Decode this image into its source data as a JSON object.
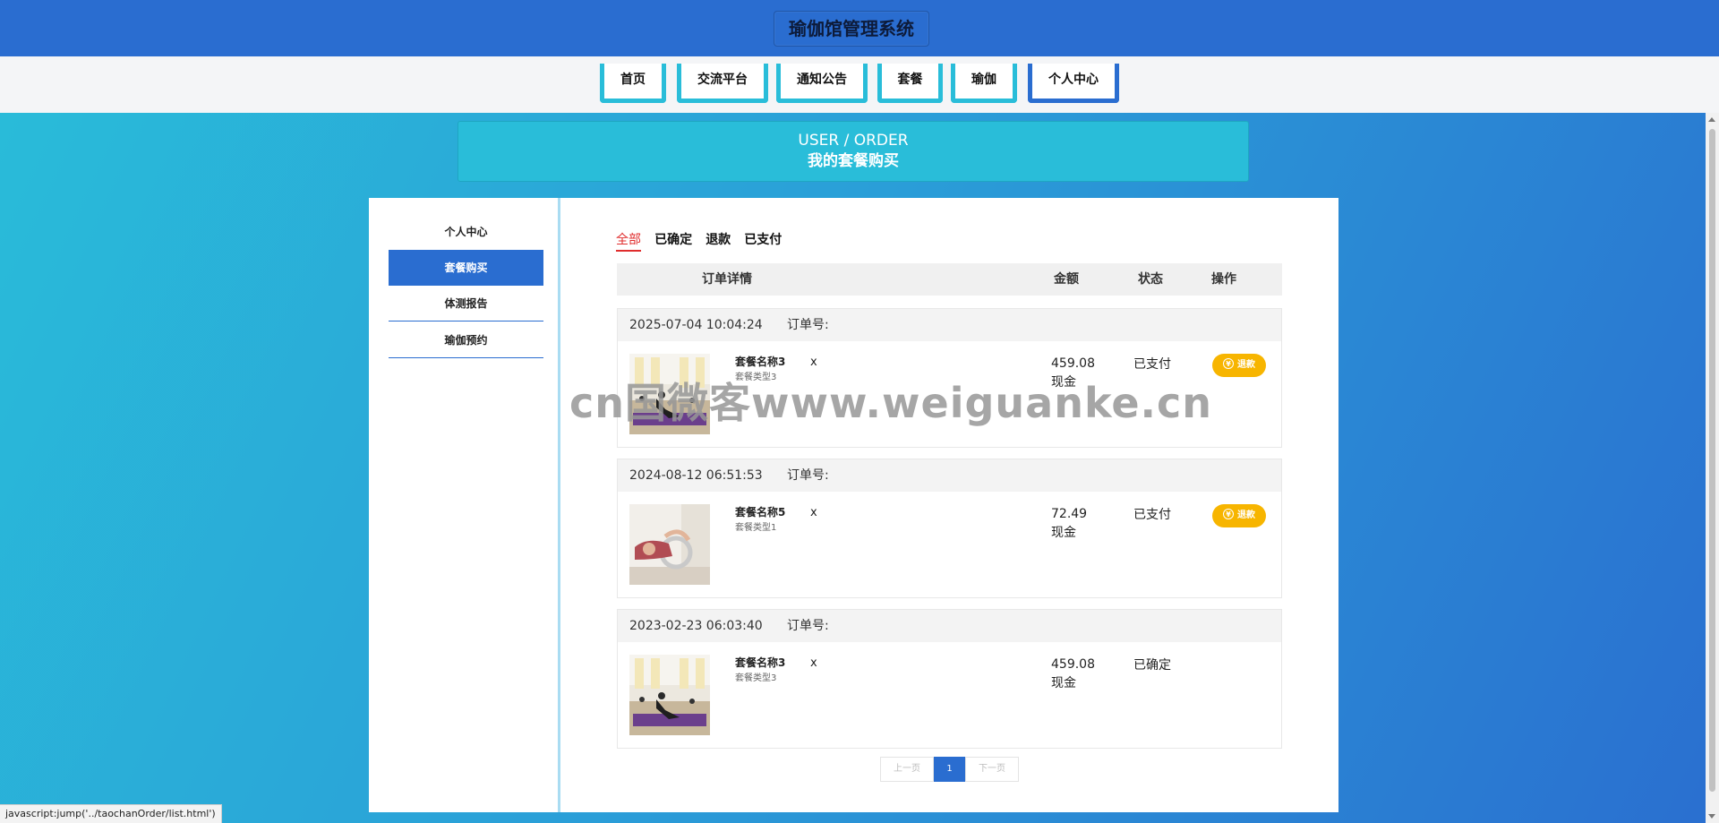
{
  "header": {
    "title": "瑜伽馆管理系统"
  },
  "nav": {
    "items": [
      {
        "label": "首页"
      },
      {
        "label": "交流平台"
      },
      {
        "label": "通知公告"
      },
      {
        "label": "套餐"
      },
      {
        "label": "瑜伽"
      },
      {
        "label": "个人中心",
        "active": true
      }
    ]
  },
  "banner": {
    "en": "USER / ORDER",
    "cn": "我的套餐购买"
  },
  "sidebar": {
    "items": [
      {
        "label": "个人中心"
      },
      {
        "label": "套餐购买",
        "active": true
      },
      {
        "label": "体测报告"
      },
      {
        "label": "瑜伽预约"
      }
    ]
  },
  "tabs": [
    {
      "label": "全部",
      "active": true
    },
    {
      "label": "已确定"
    },
    {
      "label": "退款"
    },
    {
      "label": "已支付"
    }
  ],
  "table_header": {
    "detail": "订单详情",
    "amount": "金额",
    "status": "状态",
    "action": "操作"
  },
  "orders": [
    {
      "time": "2025-07-04 10:04:24",
      "order_no_label": "订单号:",
      "product_name": "套餐名称3",
      "product_type": "套餐类型3",
      "qty": "x",
      "amount": "459.08",
      "pay_method": "现金",
      "status": "已支付",
      "action": "退款",
      "image": "yoga-class-photo"
    },
    {
      "time": "2024-08-12 06:51:53",
      "order_no_label": "订单号:",
      "product_name": "套餐名称5",
      "product_type": "套餐类型1",
      "qty": "x",
      "amount": "72.49",
      "pay_method": "现金",
      "status": "已支付",
      "action": "退款",
      "image": "yoga-wheel-photo"
    },
    {
      "time": "2023-02-23 06:03:40",
      "order_no_label": "订单号:",
      "product_name": "套餐名称3",
      "product_type": "套餐类型3",
      "qty": "x",
      "amount": "459.08",
      "pay_method": "现金",
      "status": "已确定",
      "image": "yoga-class-photo"
    }
  ],
  "pagination": {
    "prev": "上一页",
    "current": "1",
    "next": "下一页"
  },
  "watermark": "cn国微客www.weiguanke.cn",
  "statusbar": "javascript:jump('../taochanOrder/list.html')",
  "colors": {
    "primary": "#2a6dd0",
    "accent": "#29bdd9",
    "refund": "#f7b500",
    "active_tab": "#e02d2d"
  }
}
